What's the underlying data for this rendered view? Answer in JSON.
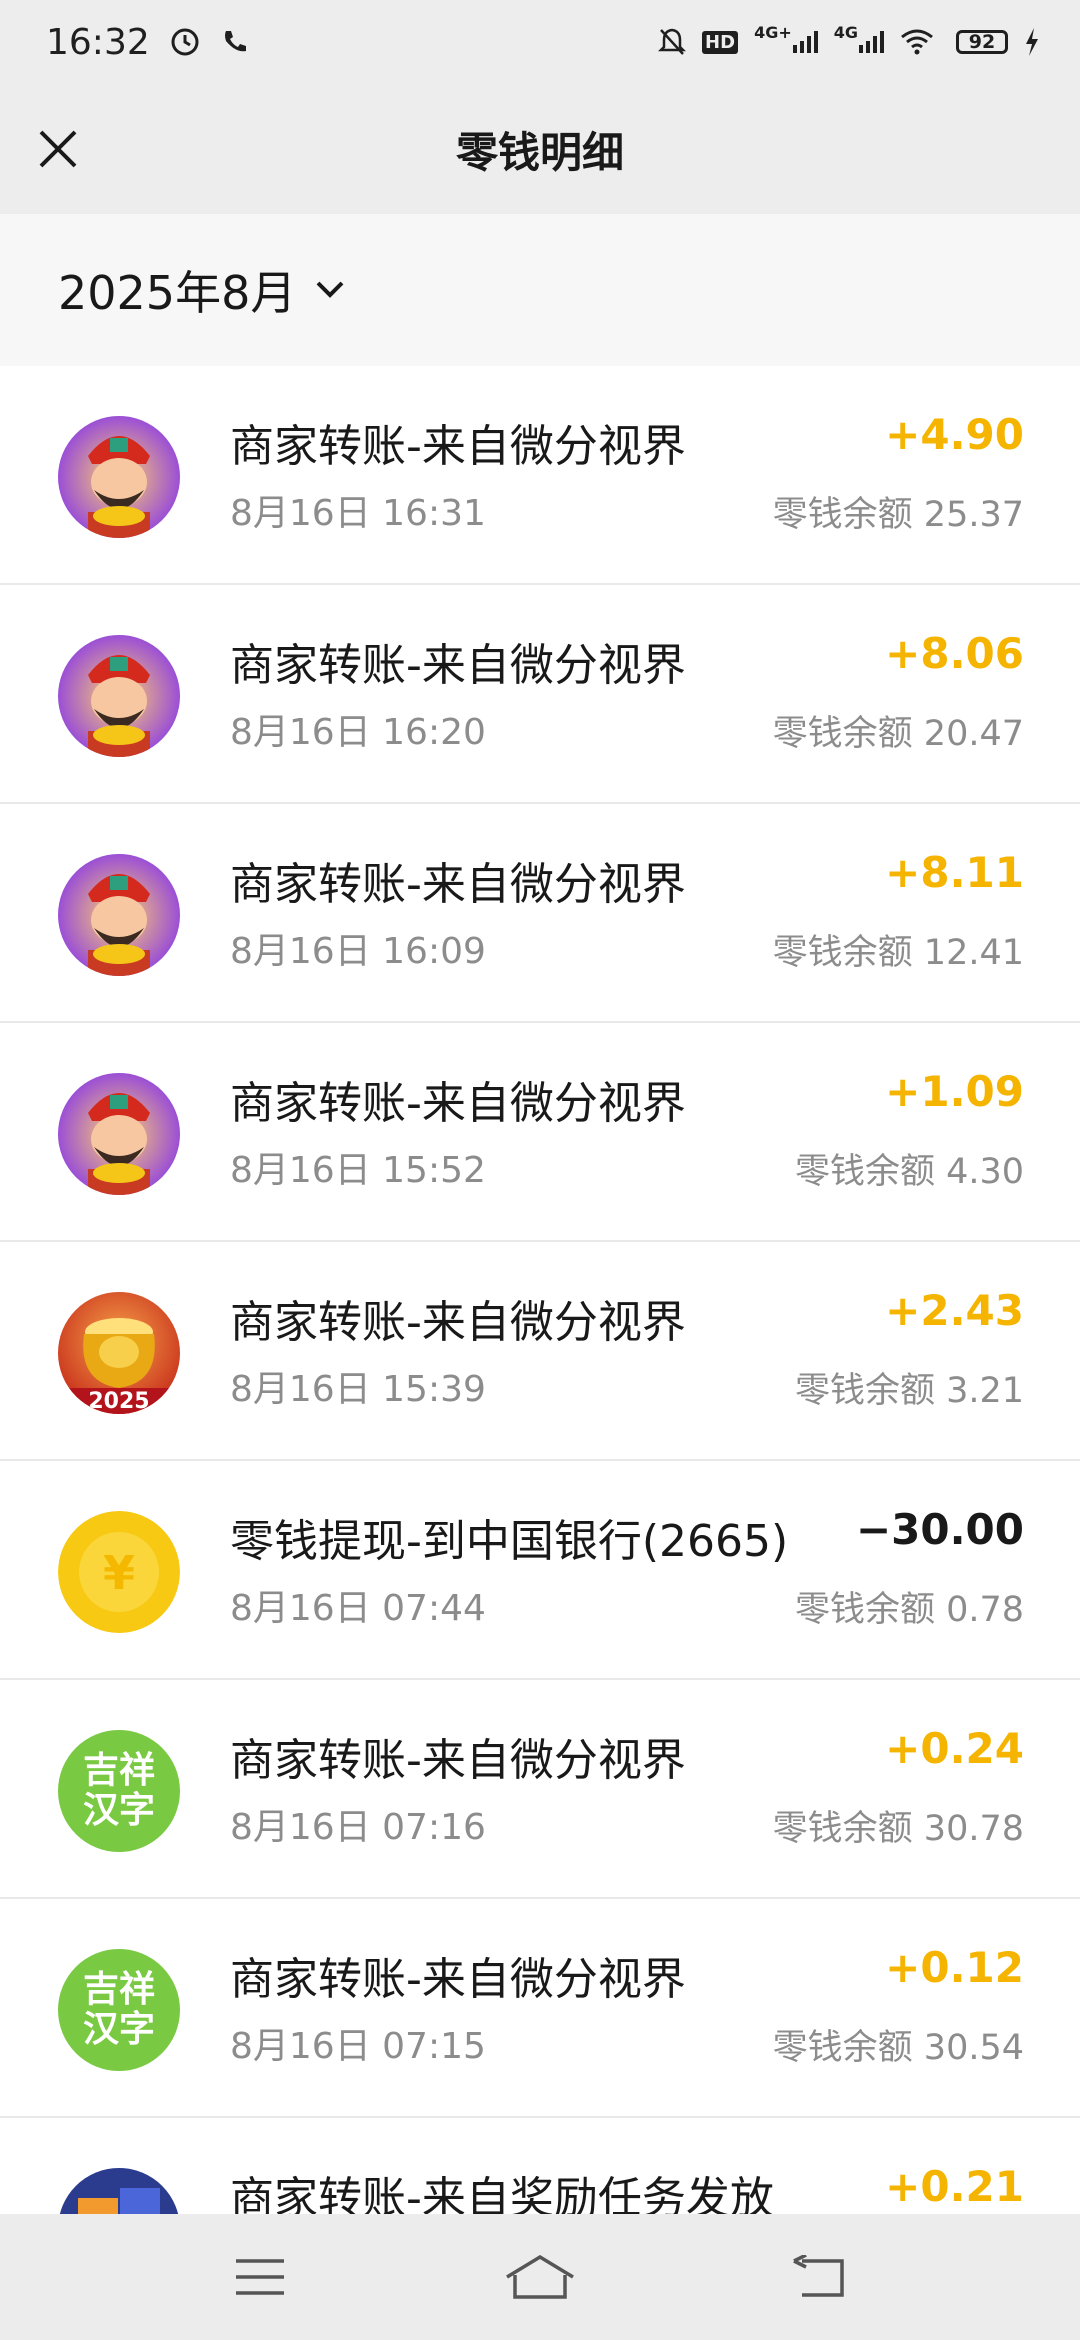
{
  "status_bar": {
    "time": "16:32",
    "battery": "92",
    "network1": "4G+",
    "network2": "4G",
    "hd": "HD"
  },
  "header": {
    "title": "零钱明细"
  },
  "filter": {
    "month": "2025年8月"
  },
  "transactions": [
    {
      "title": "商家转账-来自微分视界",
      "time": "8月16日 16:31",
      "amount": "+4.90",
      "balance": "零钱余额 25.37",
      "avatar": "god-of-wealth"
    },
    {
      "title": "商家转账-来自微分视界",
      "time": "8月16日 16:20",
      "amount": "+8.06",
      "balance": "零钱余额 20.47",
      "avatar": "god-of-wealth"
    },
    {
      "title": "商家转账-来自微分视界",
      "time": "8月16日 16:09",
      "amount": "+8.11",
      "balance": "零钱余额 12.41",
      "avatar": "god-of-wealth"
    },
    {
      "title": "商家转账-来自微分视界",
      "time": "8月16日 15:52",
      "amount": "+1.09",
      "balance": "零钱余额 4.30",
      "avatar": "god-of-wealth"
    },
    {
      "title": "商家转账-来自微分视界",
      "time": "8月16日 15:39",
      "amount": "+2.43",
      "balance": "零钱余额 3.21",
      "avatar": "treasure-pot",
      "avatar_text": "2025"
    },
    {
      "title": "零钱提现-到中国银行(2665)",
      "time": "8月16日 07:44",
      "amount": "−30.00",
      "balance": "零钱余额 0.78",
      "avatar": "yuan-coin",
      "avatar_text": "¥"
    },
    {
      "title": "商家转账-来自微分视界",
      "time": "8月16日 07:16",
      "amount": "+0.24",
      "balance": "零钱余额 30.78",
      "avatar": "jixiang-hanzi",
      "avatar_text": "吉祥汉字"
    },
    {
      "title": "商家转账-来自微分视界",
      "time": "8月16日 07:15",
      "amount": "+0.12",
      "balance": "零钱余额 30.54",
      "avatar": "jixiang-hanzi",
      "avatar_text": "吉祥汉字"
    },
    {
      "title": "商家转账-来自奖励任务发放",
      "time": "",
      "amount": "+0.21",
      "balance": "",
      "avatar": "reward-task"
    }
  ],
  "colors": {
    "income": "#f4b400",
    "expense": "#191919",
    "muted": "#8c8c8c"
  }
}
